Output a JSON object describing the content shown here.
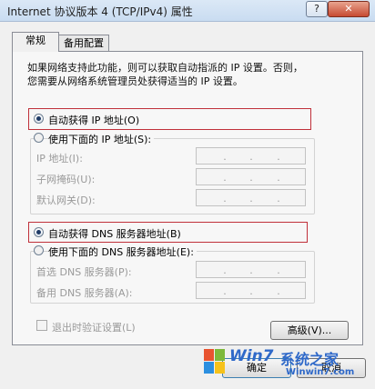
{
  "window": {
    "title": "Internet 协议版本 4 (TCP/IPv4) 属性",
    "help_label": "?",
    "close_label": "✕"
  },
  "tabs": [
    {
      "label": "常规",
      "active": true
    },
    {
      "label": "备用配置",
      "active": false
    }
  ],
  "description": {
    "line1": "如果网络支持此功能，则可以获取自动指派的 IP 设置。否则，",
    "line2": "您需要从网络系统管理员处获得适当的 IP 设置。"
  },
  "ip": {
    "auto_label": "自动获得 IP 地址(O)",
    "manual_label": "使用下面的 IP 地址(S):",
    "selected": "auto",
    "fields": [
      {
        "label": "IP 地址(I):",
        "value": ""
      },
      {
        "label": "子网掩码(U):",
        "value": ""
      },
      {
        "label": "默认网关(D):",
        "value": ""
      }
    ]
  },
  "dns": {
    "auto_label": "自动获得 DNS 服务器地址(B)",
    "manual_label": "使用下面的 DNS 服务器地址(E):",
    "selected": "auto",
    "fields": [
      {
        "label": "首选 DNS 服务器(P):",
        "value": ""
      },
      {
        "label": "备用 DNS 服务器(A):",
        "value": ""
      }
    ]
  },
  "validate": {
    "label": "退出时验证设置(L)",
    "checked": false
  },
  "buttons": {
    "advanced": "高级(V)...",
    "ok": "确定",
    "cancel": "取消"
  },
  "watermark": {
    "brand": "Win7",
    "cn": "系统之家",
    "url": "Winwin7.com"
  },
  "colors": {
    "highlight_frame": "#c0303a",
    "watermark": "#2f69c9"
  }
}
